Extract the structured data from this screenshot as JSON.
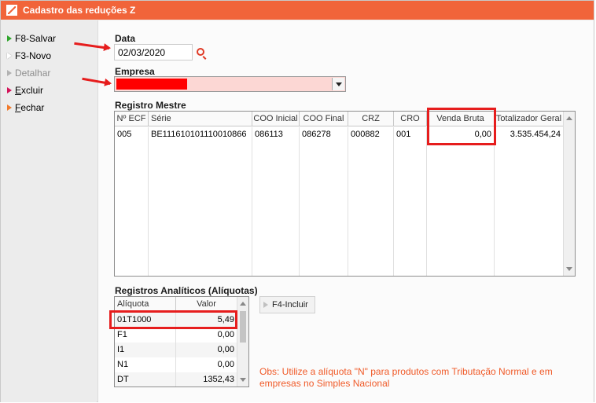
{
  "window": {
    "title": "Cadastro das reduções Z"
  },
  "sidebar": {
    "items": [
      {
        "label": "F8-Salvar",
        "underline": ""
      },
      {
        "label": "F3-Novo",
        "underline": ""
      },
      {
        "label": "Detalhar",
        "underline": ""
      },
      {
        "prefix": "E",
        "label": "xcluir"
      },
      {
        "prefix": "F",
        "label": "echar"
      }
    ]
  },
  "form": {
    "data_label": "Data",
    "data_value": "02/03/2020",
    "empresa_label": "Empresa"
  },
  "registro_mestre": {
    "title": "Registro Mestre",
    "columns": [
      "Nº ECF",
      "Série",
      "COO Inicial",
      "COO Final",
      "CRZ",
      "CRO",
      "Venda Bruta",
      "Totalizador Geral"
    ],
    "rows": [
      [
        "005",
        "BE111610101110010866",
        "086113",
        "086278",
        "000882",
        "001",
        "0,00",
        "3.535.454,24"
      ]
    ]
  },
  "registros_analiticos": {
    "title": "Registros Analíticos (Alíquotas)",
    "columns": [
      "Alíquota",
      "Valor"
    ],
    "rows": [
      [
        "01T1000",
        "5,49"
      ],
      [
        "F1",
        "0,00"
      ],
      [
        "I1",
        "0,00"
      ],
      [
        "N1",
        "0,00"
      ],
      [
        "DT",
        "1352,43"
      ]
    ]
  },
  "buttons": {
    "incluir": "F4-Incluir"
  },
  "obs": "Obs: Utilize a alíquota \"N\" para produtos com Tributação Normal e em empresas no Simples Nacional",
  "colors": {
    "accent": "#f1643a",
    "highlight": "#e61d1d",
    "obs_text": "#f05a28",
    "empresa_bg": "#fcd7d4"
  }
}
